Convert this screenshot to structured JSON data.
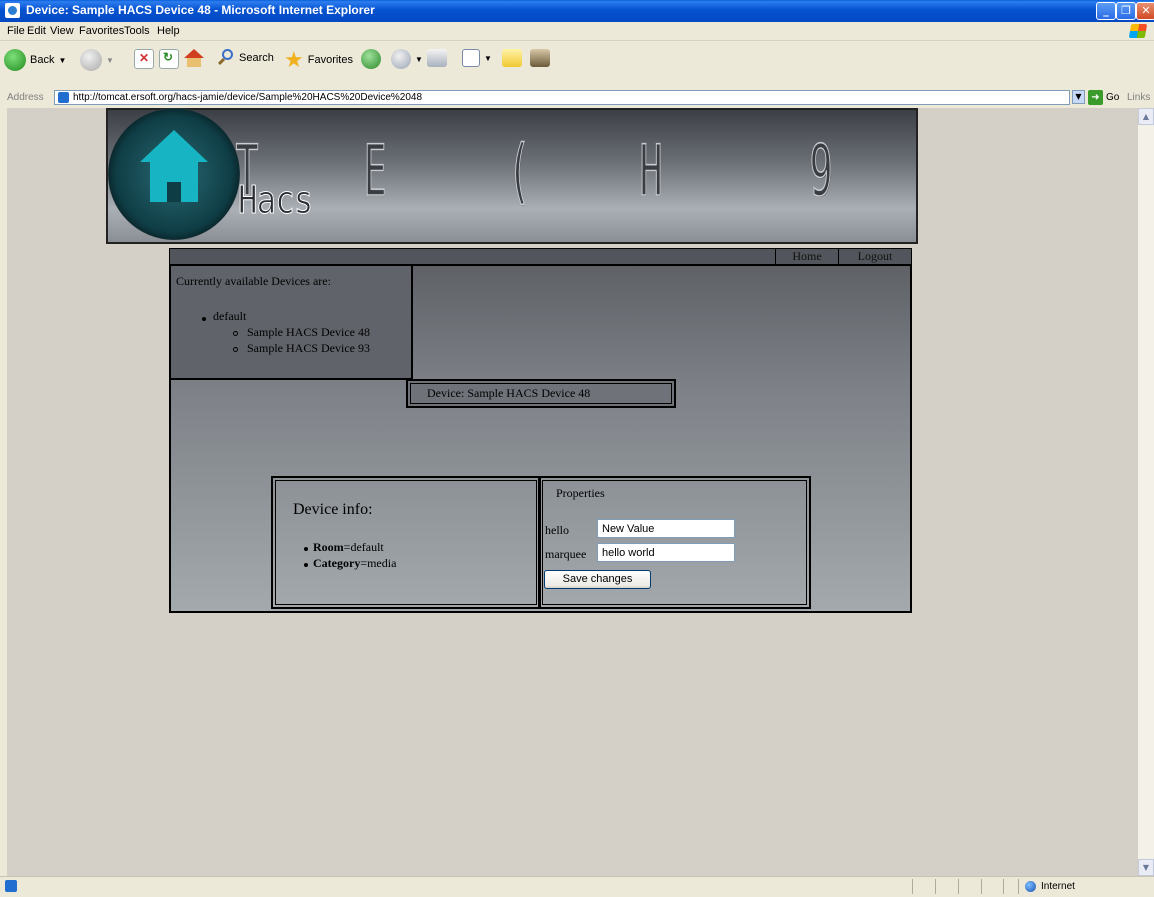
{
  "window": {
    "title": "Device: Sample HACS Device 48 - Microsoft Internet Explorer"
  },
  "menu": [
    "File",
    "Edit",
    "View",
    "Favorites",
    "Tools",
    "Help"
  ],
  "toolbar": {
    "back_label": "Back",
    "search_label": "Search",
    "favorites_label": "Favorites"
  },
  "addressbar": {
    "label": "Address",
    "url": "http://tomcat.ersoft.org/hacs-jamie/device/Sample%20HACS%20Device%2048",
    "go_label": "Go",
    "links_label": "Links"
  },
  "banner": {
    "logo_text": "Hacs",
    "glyphs": [
      "T",
      "E",
      "(",
      "H",
      "9"
    ]
  },
  "nav": {
    "home_label": "Home",
    "logout_label": "Logout"
  },
  "devices": {
    "heading": "Currently available Devices are:",
    "group": "default",
    "items": [
      "Sample HACS Device 48",
      "Sample HACS Device 93"
    ]
  },
  "device_title": "Device: Sample HACS Device 48",
  "device_info": {
    "title": "Device info:",
    "rows": [
      {
        "key": "Room",
        "value": "=default"
      },
      {
        "key": "Category",
        "value": "=media"
      }
    ]
  },
  "properties": {
    "title": "Properties",
    "fields": [
      {
        "label": "hello",
        "value": "New Value"
      },
      {
        "label": "marquee",
        "value": "hello world"
      }
    ],
    "save_label": "Save changes"
  },
  "status": {
    "zone": "Internet"
  }
}
